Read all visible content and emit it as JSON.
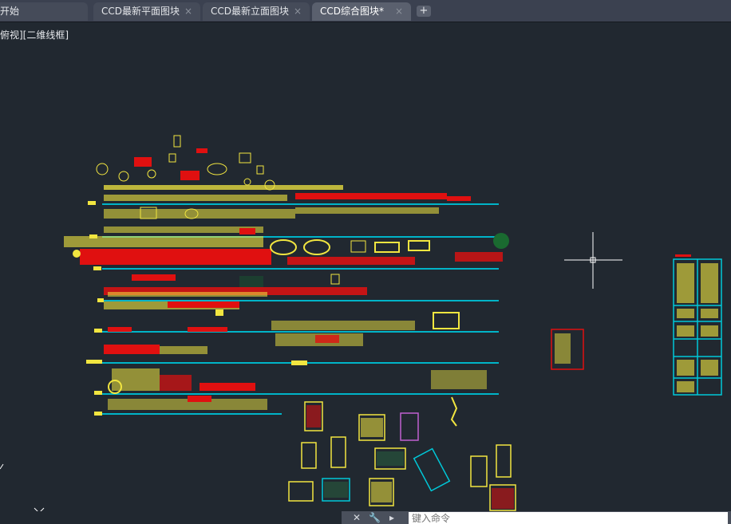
{
  "tabs": [
    {
      "label": "开始",
      "closable": false,
      "active": false
    },
    {
      "label": "CCD最新平面图块",
      "closable": true,
      "active": false
    },
    {
      "label": "CCD最新立面图块",
      "closable": true,
      "active": false
    },
    {
      "label": "CCD综合图块*",
      "closable": true,
      "active": true
    }
  ],
  "icons": {
    "close": "×",
    "new_tab": "+",
    "cmd_close": "✕",
    "cmd_settings": "🔧",
    "cmd_prompt": "▸"
  },
  "viewport": {
    "label": "俯视][二维线框]"
  },
  "command": {
    "placeholder": "键入命令"
  },
  "colors": {
    "background": "#212830",
    "guide_line": "#00b4c8",
    "yellow": "#f2e640",
    "red": "#e01010",
    "cyan_frame": "#00c8d8"
  }
}
